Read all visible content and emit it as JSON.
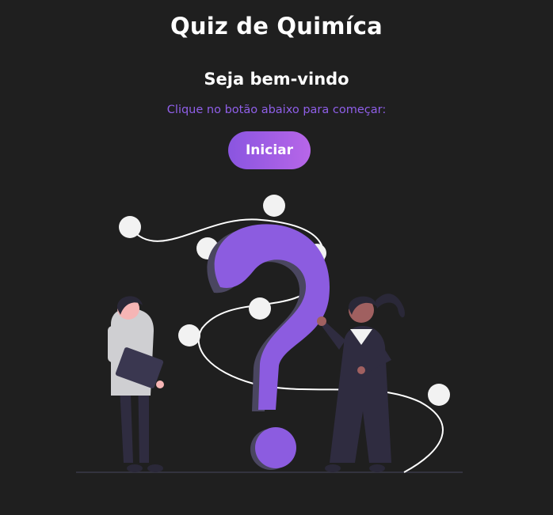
{
  "header": {
    "title": "Quiz de Quimíca"
  },
  "welcome": {
    "heading": "Seja bem-vindo",
    "hint": "Clique no botão abaixo para começar:",
    "start_label": "Iniciar"
  },
  "colors": {
    "background": "#1f1f1f",
    "accent": "#8f5fe8",
    "button_gradient_start": "#8a55e0",
    "button_gradient_end": "#b766e8",
    "question_mark": "#8c5ce0"
  },
  "illustration": {
    "icon": "question-people-illustration"
  }
}
